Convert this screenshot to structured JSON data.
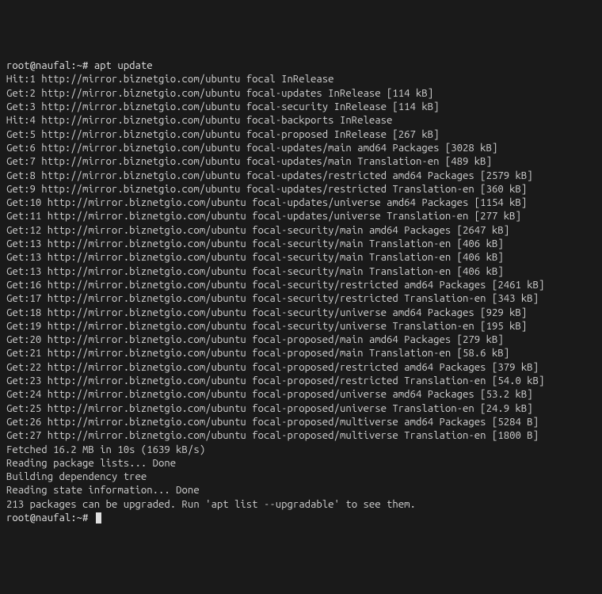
{
  "prompt1": {
    "full": "root@naufal:~# ",
    "command": "apt update"
  },
  "lines": [
    "Hit:1 http://mirror.biznetgio.com/ubuntu focal InRelease",
    "Get:2 http://mirror.biznetgio.com/ubuntu focal-updates InRelease [114 kB]",
    "Get:3 http://mirror.biznetgio.com/ubuntu focal-security InRelease [114 kB]",
    "Hit:4 http://mirror.biznetgio.com/ubuntu focal-backports InRelease",
    "Get:5 http://mirror.biznetgio.com/ubuntu focal-proposed InRelease [267 kB]",
    "Get:6 http://mirror.biznetgio.com/ubuntu focal-updates/main amd64 Packages [3028 kB]",
    "Get:7 http://mirror.biznetgio.com/ubuntu focal-updates/main Translation-en [489 kB]",
    "Get:8 http://mirror.biznetgio.com/ubuntu focal-updates/restricted amd64 Packages [2579 kB]",
    "Get:9 http://mirror.biznetgio.com/ubuntu focal-updates/restricted Translation-en [360 kB]",
    "Get:10 http://mirror.biznetgio.com/ubuntu focal-updates/universe amd64 Packages [1154 kB]",
    "Get:11 http://mirror.biznetgio.com/ubuntu focal-updates/universe Translation-en [277 kB]",
    "Get:12 http://mirror.biznetgio.com/ubuntu focal-security/main amd64 Packages [2647 kB]",
    "Get:13 http://mirror.biznetgio.com/ubuntu focal-security/main Translation-en [406 kB]",
    "Get:13 http://mirror.biznetgio.com/ubuntu focal-security/main Translation-en [406 kB]",
    "Get:13 http://mirror.biznetgio.com/ubuntu focal-security/main Translation-en [406 kB]",
    "Get:16 http://mirror.biznetgio.com/ubuntu focal-security/restricted amd64 Packages [2461 kB]",
    "Get:17 http://mirror.biznetgio.com/ubuntu focal-security/restricted Translation-en [343 kB]",
    "Get:18 http://mirror.biznetgio.com/ubuntu focal-security/universe amd64 Packages [929 kB]",
    "Get:19 http://mirror.biznetgio.com/ubuntu focal-security/universe Translation-en [195 kB]",
    "Get:20 http://mirror.biznetgio.com/ubuntu focal-proposed/main amd64 Packages [279 kB]",
    "Get:21 http://mirror.biznetgio.com/ubuntu focal-proposed/main Translation-en [58.6 kB]",
    "Get:22 http://mirror.biznetgio.com/ubuntu focal-proposed/restricted amd64 Packages [379 kB]",
    "Get:23 http://mirror.biznetgio.com/ubuntu focal-proposed/restricted Translation-en [54.0 kB]",
    "Get:24 http://mirror.biznetgio.com/ubuntu focal-proposed/universe amd64 Packages [53.2 kB]",
    "Get:25 http://mirror.biznetgio.com/ubuntu focal-proposed/universe Translation-en [24.9 kB]",
    "Get:26 http://mirror.biznetgio.com/ubuntu focal-proposed/multiverse amd64 Packages [5284 B]",
    "Get:27 http://mirror.biznetgio.com/ubuntu focal-proposed/multiverse Translation-en [1800 B]",
    "Fetched 16.2 MB in 10s (1639 kB/s)",
    "Reading package lists... Done",
    "Building dependency tree",
    "Reading state information... Done",
    "213 packages can be upgraded. Run 'apt list --upgradable' to see them."
  ],
  "prompt2": {
    "full": "root@naufal:~# "
  }
}
